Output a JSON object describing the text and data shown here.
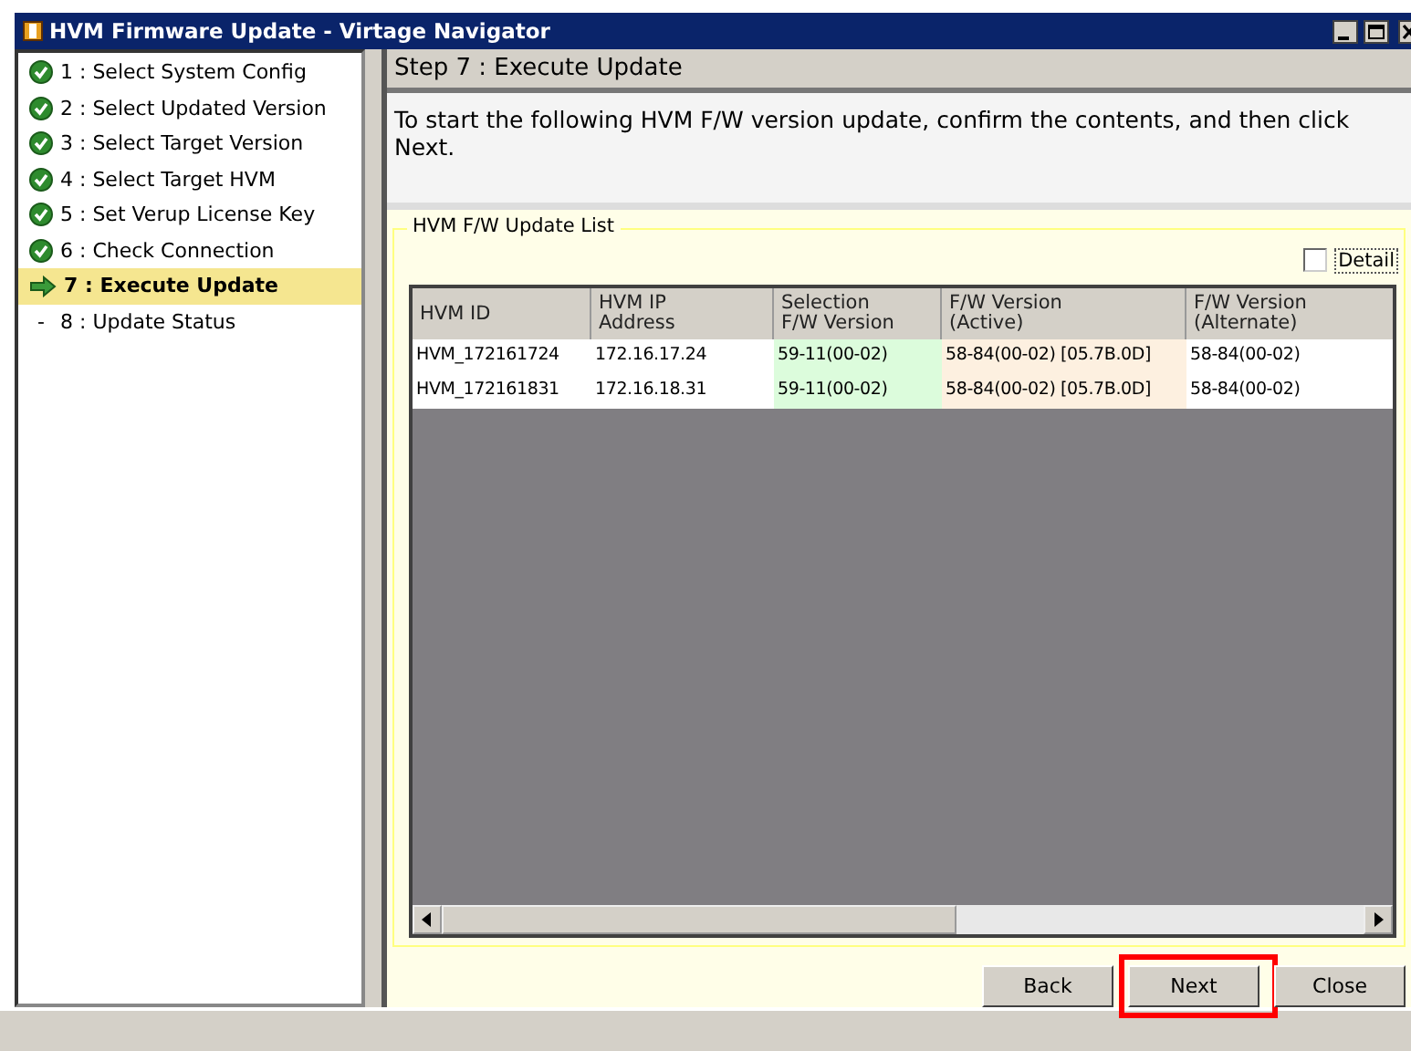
{
  "window": {
    "title": "HVM Firmware Update - Virtage Navigator"
  },
  "steps": [
    {
      "label": "1 : Select System Config",
      "kind": "done",
      "selected": false
    },
    {
      "label": "2 : Select Updated Version",
      "kind": "done",
      "selected": false
    },
    {
      "label": "3 : Select Target Version",
      "kind": "done",
      "selected": false
    },
    {
      "label": "4 : Select Target HVM",
      "kind": "done",
      "selected": false
    },
    {
      "label": "5 : Set Verup License Key",
      "kind": "done",
      "selected": false
    },
    {
      "label": "6 : Check Connection",
      "kind": "done",
      "selected": false
    },
    {
      "label": "7 : Execute Update",
      "kind": "current",
      "selected": true
    },
    {
      "label": "8 : Update Status",
      "kind": "pending",
      "marker": "-",
      "selected": false
    }
  ],
  "step_header": "Step 7 : Execute Update",
  "description": "To start the following HVM F/W version update, confirm the contents, and then click Next.",
  "group": {
    "title": "HVM F/W Update List",
    "detail": {
      "label": "Detail",
      "checked": false
    },
    "table": {
      "columns": [
        {
          "label": "HVM ID"
        },
        {
          "label": "HVM IP\nAddress"
        },
        {
          "label": "Selection\nF/W Version",
          "color": "#dcfcdc"
        },
        {
          "label": "F/W Version\n(Active)",
          "color": "#fdf0e0"
        },
        {
          "label": "F/W Version\n(Alternate)"
        }
      ],
      "rows": [
        [
          "HVM_172161724",
          "172.16.17.24",
          "59-11(00-02)",
          "58-84(00-02) [05.7B.0D]",
          "58-84(00-02)"
        ],
        [
          "HVM_172161831",
          "172.16.18.31",
          "59-11(00-02)",
          "58-84(00-02) [05.7B.0D]",
          "58-84(00-02)"
        ]
      ]
    }
  },
  "buttons": [
    {
      "label": "Back",
      "highlighted": false
    },
    {
      "label": "Next",
      "highlighted": true
    },
    {
      "label": "Close",
      "highlighted": false
    }
  ]
}
